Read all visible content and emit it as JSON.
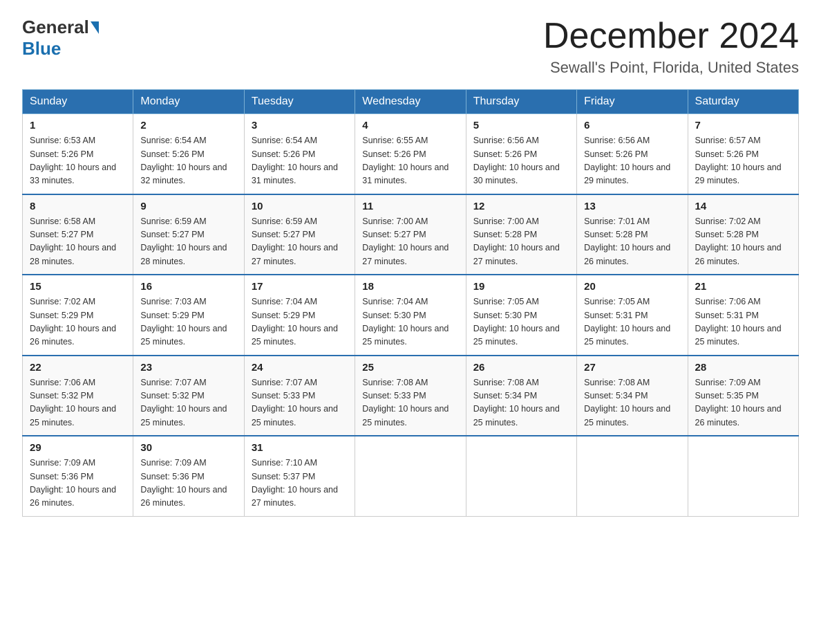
{
  "header": {
    "logo_general": "General",
    "logo_blue": "Blue",
    "month_title": "December 2024",
    "location": "Sewall's Point, Florida, United States"
  },
  "weekdays": [
    "Sunday",
    "Monday",
    "Tuesday",
    "Wednesday",
    "Thursday",
    "Friday",
    "Saturday"
  ],
  "weeks": [
    [
      {
        "day": "1",
        "sunrise": "6:53 AM",
        "sunset": "5:26 PM",
        "daylight": "10 hours and 33 minutes."
      },
      {
        "day": "2",
        "sunrise": "6:54 AM",
        "sunset": "5:26 PM",
        "daylight": "10 hours and 32 minutes."
      },
      {
        "day": "3",
        "sunrise": "6:54 AM",
        "sunset": "5:26 PM",
        "daylight": "10 hours and 31 minutes."
      },
      {
        "day": "4",
        "sunrise": "6:55 AM",
        "sunset": "5:26 PM",
        "daylight": "10 hours and 31 minutes."
      },
      {
        "day": "5",
        "sunrise": "6:56 AM",
        "sunset": "5:26 PM",
        "daylight": "10 hours and 30 minutes."
      },
      {
        "day": "6",
        "sunrise": "6:56 AM",
        "sunset": "5:26 PM",
        "daylight": "10 hours and 29 minutes."
      },
      {
        "day": "7",
        "sunrise": "6:57 AM",
        "sunset": "5:26 PM",
        "daylight": "10 hours and 29 minutes."
      }
    ],
    [
      {
        "day": "8",
        "sunrise": "6:58 AM",
        "sunset": "5:27 PM",
        "daylight": "10 hours and 28 minutes."
      },
      {
        "day": "9",
        "sunrise": "6:59 AM",
        "sunset": "5:27 PM",
        "daylight": "10 hours and 28 minutes."
      },
      {
        "day": "10",
        "sunrise": "6:59 AM",
        "sunset": "5:27 PM",
        "daylight": "10 hours and 27 minutes."
      },
      {
        "day": "11",
        "sunrise": "7:00 AM",
        "sunset": "5:27 PM",
        "daylight": "10 hours and 27 minutes."
      },
      {
        "day": "12",
        "sunrise": "7:00 AM",
        "sunset": "5:28 PM",
        "daylight": "10 hours and 27 minutes."
      },
      {
        "day": "13",
        "sunrise": "7:01 AM",
        "sunset": "5:28 PM",
        "daylight": "10 hours and 26 minutes."
      },
      {
        "day": "14",
        "sunrise": "7:02 AM",
        "sunset": "5:28 PM",
        "daylight": "10 hours and 26 minutes."
      }
    ],
    [
      {
        "day": "15",
        "sunrise": "7:02 AM",
        "sunset": "5:29 PM",
        "daylight": "10 hours and 26 minutes."
      },
      {
        "day": "16",
        "sunrise": "7:03 AM",
        "sunset": "5:29 PM",
        "daylight": "10 hours and 25 minutes."
      },
      {
        "day": "17",
        "sunrise": "7:04 AM",
        "sunset": "5:29 PM",
        "daylight": "10 hours and 25 minutes."
      },
      {
        "day": "18",
        "sunrise": "7:04 AM",
        "sunset": "5:30 PM",
        "daylight": "10 hours and 25 minutes."
      },
      {
        "day": "19",
        "sunrise": "7:05 AM",
        "sunset": "5:30 PM",
        "daylight": "10 hours and 25 minutes."
      },
      {
        "day": "20",
        "sunrise": "7:05 AM",
        "sunset": "5:31 PM",
        "daylight": "10 hours and 25 minutes."
      },
      {
        "day": "21",
        "sunrise": "7:06 AM",
        "sunset": "5:31 PM",
        "daylight": "10 hours and 25 minutes."
      }
    ],
    [
      {
        "day": "22",
        "sunrise": "7:06 AM",
        "sunset": "5:32 PM",
        "daylight": "10 hours and 25 minutes."
      },
      {
        "day": "23",
        "sunrise": "7:07 AM",
        "sunset": "5:32 PM",
        "daylight": "10 hours and 25 minutes."
      },
      {
        "day": "24",
        "sunrise": "7:07 AM",
        "sunset": "5:33 PM",
        "daylight": "10 hours and 25 minutes."
      },
      {
        "day": "25",
        "sunrise": "7:08 AM",
        "sunset": "5:33 PM",
        "daylight": "10 hours and 25 minutes."
      },
      {
        "day": "26",
        "sunrise": "7:08 AM",
        "sunset": "5:34 PM",
        "daylight": "10 hours and 25 minutes."
      },
      {
        "day": "27",
        "sunrise": "7:08 AM",
        "sunset": "5:34 PM",
        "daylight": "10 hours and 25 minutes."
      },
      {
        "day": "28",
        "sunrise": "7:09 AM",
        "sunset": "5:35 PM",
        "daylight": "10 hours and 26 minutes."
      }
    ],
    [
      {
        "day": "29",
        "sunrise": "7:09 AM",
        "sunset": "5:36 PM",
        "daylight": "10 hours and 26 minutes."
      },
      {
        "day": "30",
        "sunrise": "7:09 AM",
        "sunset": "5:36 PM",
        "daylight": "10 hours and 26 minutes."
      },
      {
        "day": "31",
        "sunrise": "7:10 AM",
        "sunset": "5:37 PM",
        "daylight": "10 hours and 27 minutes."
      },
      null,
      null,
      null,
      null
    ]
  ]
}
